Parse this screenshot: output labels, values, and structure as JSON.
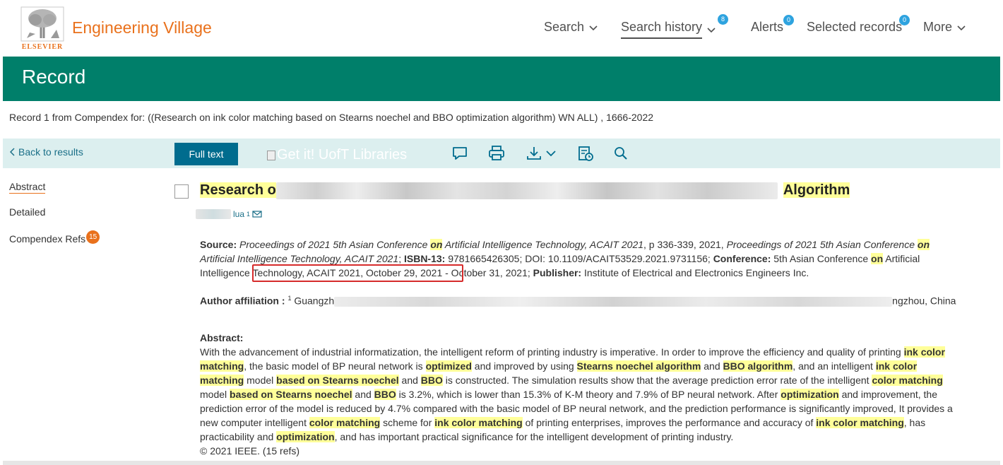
{
  "header": {
    "logo_word": "ELSEVIER",
    "brand": "Engineering Village",
    "nav": {
      "search": "Search",
      "search_history": "Search history",
      "search_history_count": "8",
      "alerts": "Alerts",
      "alerts_count": "0",
      "selected_records": "Selected records",
      "selected_records_count": "0",
      "more": "More"
    }
  },
  "band": {
    "title": "Record"
  },
  "record_info": "Record 1 from Compendex for: ((Research on ink color matching based on Stearns noechel and BBO optimization algorithm) WN ALL) , 1666-2022",
  "toolbar": {
    "back": "Back to results",
    "full_text": "Full text",
    "get_it": "Get it! UofT Libraries"
  },
  "sidebar": {
    "abstract": "Abstract",
    "detailed": "Detailed",
    "compendex_refs": "Compendex Refs",
    "compendex_refs_count": "15"
  },
  "record": {
    "title_start": "Research o",
    "title_end": "Algorithm",
    "author_visible": "lua",
    "author_sup": "1",
    "source": {
      "label": "Source:",
      "t1": " Proceedings of 2021 5th Asian Conference ",
      "on": "on",
      "t2": " Artificial Intelligence Technology, ACAIT 2021",
      "t3": ", p 336-339, 2021, ",
      "t4": "Proceedings of 2021 5th Asian Conference ",
      "t5": " Artificial Intelligence Technology, ACAIT 2021",
      "t6": ";  ",
      "isbn_label": "ISBN-13:",
      "isbn": " 9781665426305;  DOI: 10.1109/ACAIT53529.2021.9731156; ",
      "conf_label": "Conference:",
      "conf1": " 5th Asian Conference ",
      "conf2": " Artificial Intelligence Technology, ACAIT 2021, October 29, 2021 - October 31, 2021; ",
      "publisher_label": "Publisher:",
      "publisher": " Institute of Electrical and Electronics Engineers Inc."
    },
    "affiliation": {
      "label": "Author affiliation :",
      "sup": "1",
      "start": " Guangzh",
      "end": "ngzhou, China"
    },
    "abstract": {
      "label": "Abstract:",
      "a1": "With the advancement of industrial informatization, the intelligent reform of printing industry is imperative. In order to improve the efficiency and quality of printing ",
      "h1": "ink color matching",
      "a2": ", the basic model of BP neural network is ",
      "h2": "optimized",
      "a3": " and improved by using ",
      "h3": "Stearns noechel algorithm",
      "a4": " and ",
      "h4": "BBO algorithm",
      "a5": ", and an intelligent ",
      "h5": "ink color matching",
      "a6": " model ",
      "h6": "based on Stearns noechel",
      "a7": " and ",
      "h7": "BBO",
      "a8": " is constructed. The simulation results show that the average prediction error rate of the intelligent ",
      "h8": "color matching",
      "a9": " model ",
      "h9": "based on Stearns noechel",
      "a10": " and ",
      "h10": "BBO",
      "a11": " is 3.2%, which is lower than 15.3% of K-M theory and 7.9% of BP neural network. After ",
      "h11": "optimization",
      "a12": " and improvement, the prediction error of the model is reduced by 4.7% compared with the basic model of BP neural network, and the prediction performance is significantly improved, It provides a new computer intelligent ",
      "h12": "color matching",
      "a13": " scheme for ",
      "h13": "ink color matching",
      "a14": " of printing enterprises, improves the performance and accuracy of ",
      "h14": "ink color matching",
      "a15": ", has practicability and ",
      "h15": "optimization",
      "a16": ", and has important practical significance for the intelligent development of printing industry.",
      "copyright": "© 2021 IEEE. (15 refs)"
    }
  },
  "colors": {
    "brand_orange": "#e9711c",
    "band_green": "#007f6a",
    "toolbar_bg": "#dcefef",
    "button_blue": "#006c8e",
    "highlight": "#ffff99",
    "badge_blue": "#2ea3df",
    "annotation_red": "#d62b2b"
  }
}
